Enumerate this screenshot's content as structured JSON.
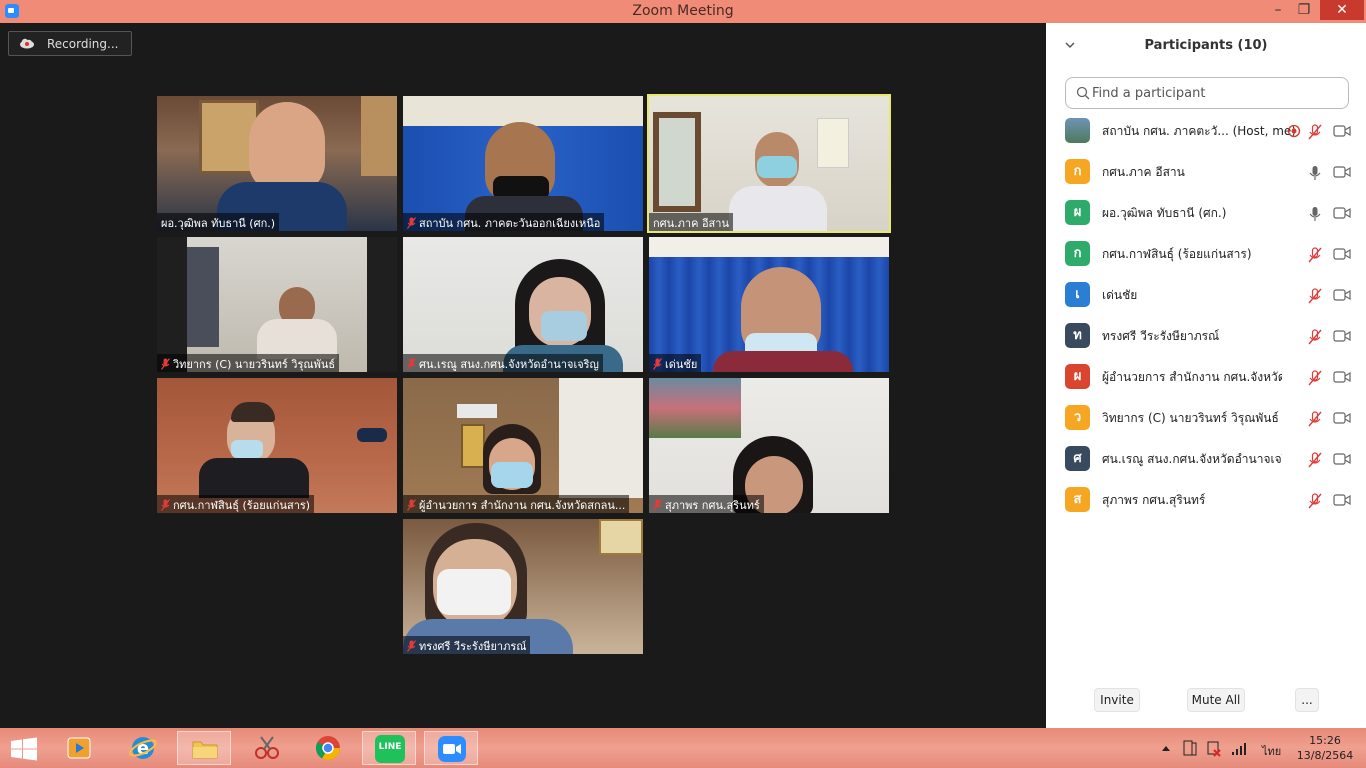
{
  "window": {
    "title": "Zoom Meeting",
    "minimize": "–",
    "maximize": "❐",
    "close": "✕"
  },
  "recording": {
    "label": "Recording..."
  },
  "video_tiles": [
    {
      "name": "ผอ.วุฒิพล ทับธานี (ศก.)",
      "muted": false,
      "active": false
    },
    {
      "name": "สถาบัน กศน. ภาคตะวันออกเฉียงเหนือ",
      "muted": true,
      "active": false
    },
    {
      "name": "กศน.ภาค อีสาน",
      "muted": false,
      "active": true
    },
    {
      "name": "วิทยากร (C) นายวรินทร์ วิรุณพันธ์",
      "muted": true,
      "active": false
    },
    {
      "name": "ศน.เรณู สนง.กศน.จังหวัดอำนาจเจริญ",
      "muted": true,
      "active": false
    },
    {
      "name": "เด่นชัย",
      "muted": true,
      "active": false
    },
    {
      "name": "กศน.กาฬสินธุ์ (ร้อยแก่นสาร)",
      "muted": true,
      "active": false
    },
    {
      "name": "ผู้อำนวยการ สำนักงาน กศน.จังหวัดสกลน...",
      "muted": true,
      "active": false
    },
    {
      "name": "สุภาพร กศน.สุรินทร์",
      "muted": true,
      "active": false
    },
    {
      "name": "ทรงศรี วีระรังษียาภรณ์",
      "muted": true,
      "active": false
    }
  ],
  "panel": {
    "title": "Participants (10)",
    "search_placeholder": "Find a participant",
    "participants": [
      {
        "initial": "",
        "name": "สถาบัน กศน. ภาคตะวั... (Host, me)",
        "color": "#4a7a9a",
        "mic": "muted",
        "recording": true
      },
      {
        "initial": "ก",
        "name": "กศน.ภาค อีสาน",
        "color": "#f5a623",
        "mic": "on",
        "recording": false
      },
      {
        "initial": "ผ",
        "name": "ผอ.วุฒิพล ทับธานี (ศก.)",
        "color": "#2eaa6a",
        "mic": "on",
        "recording": false
      },
      {
        "initial": "ก",
        "name": "กศน.กาฬสินธุ์ (ร้อยแก่นสาร)",
        "color": "#2eaa6a",
        "mic": "muted",
        "recording": false
      },
      {
        "initial": "เ",
        "name": "เด่นชัย",
        "color": "#2a7fd4",
        "mic": "muted",
        "recording": false
      },
      {
        "initial": "ท",
        "name": "ทรงศรี วีระรังษียาภรณ์",
        "color": "#3a4a5e",
        "mic": "muted",
        "recording": false
      },
      {
        "initial": "ผ",
        "name": "ผู้อำนวยการ สำนักงาน กศน.จังหวัดสก...",
        "color": "#d9452f",
        "mic": "muted",
        "recording": false
      },
      {
        "initial": "ว",
        "name": "วิทยากร (C) นายวรินทร์ วิรุณพันธ์",
        "color": "#f5a623",
        "mic": "muted",
        "recording": false
      },
      {
        "initial": "ศ",
        "name": "ศน.เรณู สนง.กศน.จังหวัดอำนาจเจริญ",
        "color": "#3a4a5e",
        "mic": "muted",
        "recording": false
      },
      {
        "initial": "ส",
        "name": "สุภาพร กศน.สุรินทร์",
        "color": "#f5a623",
        "mic": "muted",
        "recording": false
      }
    ],
    "buttons": {
      "invite": "Invite",
      "mute_all": "Mute All",
      "more": "..."
    }
  },
  "taskbar": {
    "line_label": "LINE",
    "tray_language": "ไทย",
    "time": "15:26",
    "date": "13/8/2564"
  }
}
